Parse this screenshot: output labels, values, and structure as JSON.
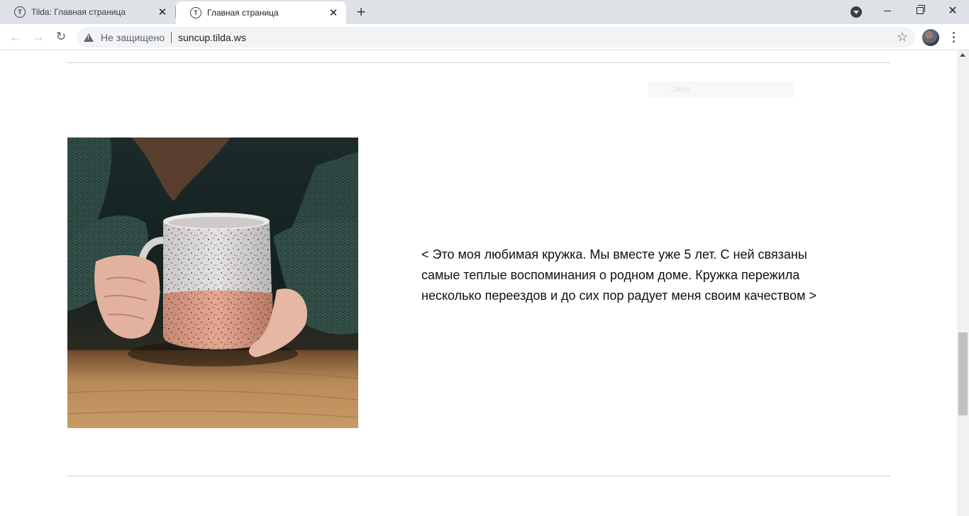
{
  "browser": {
    "tabs": [
      {
        "title": "Tilda: Главная страница",
        "active": false
      },
      {
        "title": "Главная страница",
        "active": true
      }
    ],
    "favicon_letter": "T",
    "address_bar": {
      "security_label": "Не защищено",
      "url": "suncup.tilda.ws"
    }
  },
  "page": {
    "ghost_label": "Okno",
    "image_alt": "Руки в зелёном свитере держат керамическую кружку",
    "body_text": "< Это моя любимая кружка. Мы вместе уже 5 лет. С ней связаны самые теплые воспоминания о родном доме. Кружка пережила несколько переездов и до сих пор радует меня своим качеством >"
  },
  "icons": {
    "back": "arrow-left-icon",
    "forward": "arrow-right-icon",
    "reload": "reload-icon",
    "security": "warning-icon",
    "bookmark": "star-icon",
    "menu": "kebab-menu-icon"
  }
}
